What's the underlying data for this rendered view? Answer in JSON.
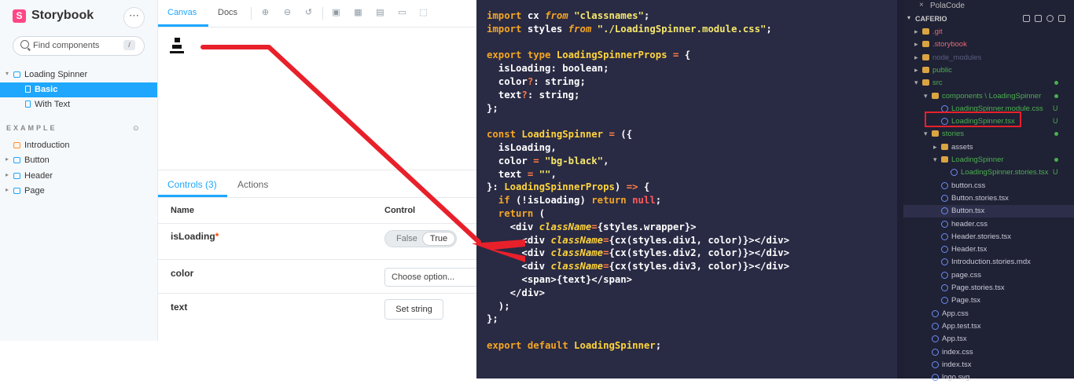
{
  "storybook": {
    "brand": "Storybook",
    "search_placeholder": "Find components",
    "search_shortcut": "/",
    "menu_label": "⋯",
    "tree": {
      "group": "Loading Spinner",
      "stories": [
        "Basic",
        "With Text"
      ],
      "section": "EXAMPLE",
      "section_toggle": "⊙",
      "example_items": [
        "Introduction",
        "Button",
        "Header",
        "Page"
      ]
    },
    "tabs": {
      "canvas": "Canvas",
      "docs": "Docs"
    },
    "addons": {
      "tabs": [
        "Controls (3)",
        "Actions"
      ],
      "headers": {
        "name": "Name",
        "control": "Control"
      },
      "rows": {
        "isLoading": {
          "name": "isLoading",
          "required_mark": "*",
          "toggle_false": "False",
          "toggle_true": "True"
        },
        "color": {
          "name": "color",
          "select_placeholder": "Choose option..."
        },
        "text": {
          "name": "text",
          "button": "Set string"
        }
      }
    }
  },
  "editor": {
    "lines": [
      "import cx from \"classnames\";",
      "import styles from \"./LoadingSpinner.module.css\";",
      "",
      "export type LoadingSpinnerProps = {",
      "  isLoading: boolean;",
      "  color?: string;",
      "  text?: string;",
      "};",
      "",
      "const LoadingSpinner = ({",
      "  isLoading,",
      "  color = \"bg-black\",",
      "  text = \"\",",
      "}: LoadingSpinnerProps) => {",
      "  if (!isLoading) return null;",
      "  return (",
      "    <div className={styles.wrapper}>",
      "      <div className={cx(styles.div1, color)}></div>",
      "      <div className={cx(styles.div2, color)}></div>",
      "      <div className={cx(styles.div3, color)}></div>",
      "      <span>{text}</span>",
      "    </div>",
      "  );",
      "};",
      "",
      "export default LoadingSpinner;"
    ]
  },
  "explorer": {
    "open_editor": "PolaCode",
    "open_close": "×",
    "project": "CAFERIO",
    "items": [
      {
        "name": ".git",
        "indent": 1,
        "kind": "folder",
        "color": "#e06c75"
      },
      {
        "name": ".storybook",
        "indent": 1,
        "kind": "folder",
        "color": "#e06c75"
      },
      {
        "name": "node_modules",
        "indent": 1,
        "kind": "folder",
        "color": "#5a5f7d"
      },
      {
        "name": "public",
        "indent": 1,
        "kind": "folder",
        "color": "#4caf50"
      },
      {
        "name": "src",
        "indent": 1,
        "kind": "folder-open",
        "color": "#4caf50",
        "status": "dot"
      },
      {
        "name": "components \\ LoadingSpinner",
        "indent": 2,
        "kind": "folder-open",
        "color": "#4caf50",
        "status": "dot"
      },
      {
        "name": "LoadingSpinner.module.css",
        "indent": 3,
        "kind": "file",
        "color": "#4caf50",
        "status": "U"
      },
      {
        "name": "LoadingSpinner.tsx",
        "indent": 3,
        "kind": "file",
        "color": "#4caf50",
        "status": "U",
        "boxed": true
      },
      {
        "name": "stories",
        "indent": 2,
        "kind": "folder-open",
        "color": "#4caf50",
        "status": "dot"
      },
      {
        "name": "assets",
        "indent": 3,
        "kind": "folder",
        "color": "#c9c9d6"
      },
      {
        "name": "LoadingSpinner",
        "indent": 3,
        "kind": "folder-open",
        "color": "#4caf50",
        "status": "dot"
      },
      {
        "name": "LoadingSpinner.stories.tsx",
        "indent": 4,
        "kind": "file",
        "color": "#4caf50",
        "status": "U"
      },
      {
        "name": "button.css",
        "indent": 3,
        "kind": "file",
        "color": "#c9c9d6"
      },
      {
        "name": "Button.stories.tsx",
        "indent": 3,
        "kind": "file",
        "color": "#c9c9d6"
      },
      {
        "name": "Button.tsx",
        "indent": 3,
        "kind": "file",
        "color": "#c9c9d6",
        "highlight": true
      },
      {
        "name": "header.css",
        "indent": 3,
        "kind": "file",
        "color": "#c9c9d6"
      },
      {
        "name": "Header.stories.tsx",
        "indent": 3,
        "kind": "file",
        "color": "#c9c9d6"
      },
      {
        "name": "Header.tsx",
        "indent": 3,
        "kind": "file",
        "color": "#c9c9d6"
      },
      {
        "name": "Introduction.stories.mdx",
        "indent": 3,
        "kind": "file",
        "color": "#c9c9d6"
      },
      {
        "name": "page.css",
        "indent": 3,
        "kind": "file",
        "color": "#c9c9d6"
      },
      {
        "name": "Page.stories.tsx",
        "indent": 3,
        "kind": "file",
        "color": "#c9c9d6"
      },
      {
        "name": "Page.tsx",
        "indent": 3,
        "kind": "file",
        "color": "#c9c9d6"
      },
      {
        "name": "App.css",
        "indent": 2,
        "kind": "file",
        "color": "#c9c9d6"
      },
      {
        "name": "App.test.tsx",
        "indent": 2,
        "kind": "file",
        "color": "#c9c9d6"
      },
      {
        "name": "App.tsx",
        "indent": 2,
        "kind": "file",
        "color": "#c9c9d6"
      },
      {
        "name": "index.css",
        "indent": 2,
        "kind": "file",
        "color": "#c9c9d6"
      },
      {
        "name": "index.tsx",
        "indent": 2,
        "kind": "file",
        "color": "#c9c9d6"
      },
      {
        "name": "logo.svg",
        "indent": 2,
        "kind": "file",
        "color": "#c9c9d6"
      }
    ]
  },
  "colors": {
    "storybook_accent": "#1ea7fd",
    "storybook_brand": "#ff4785",
    "annotation_red": "#e8202a",
    "editor_bg": "#292a44",
    "explorer_bg": "#1f2135"
  }
}
